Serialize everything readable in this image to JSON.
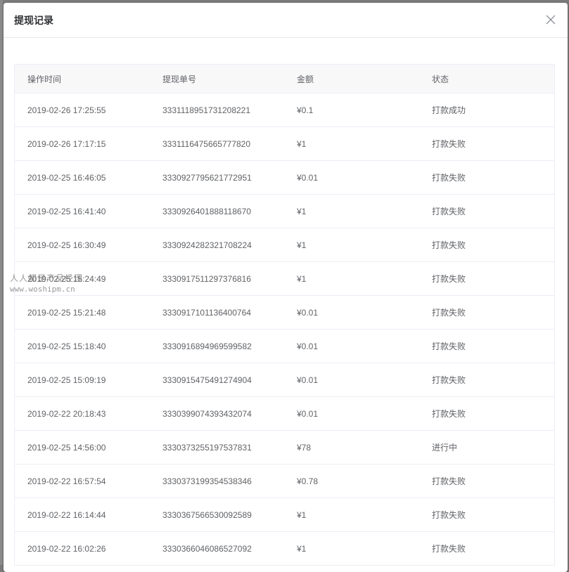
{
  "dialog": {
    "title": "提现记录",
    "close_icon": "close-icon"
  },
  "table": {
    "headers": [
      "操作时间",
      "提现单号",
      "金额",
      "状态"
    ],
    "rows": [
      [
        "2019-02-26 17:25:55",
        "3331118951731208221",
        "¥0.1",
        "打款成功"
      ],
      [
        "2019-02-26 17:17:15",
        "3331116475665777820",
        "¥1",
        "打款失败"
      ],
      [
        "2019-02-25 16:46:05",
        "3330927795621772951",
        "¥0.01",
        "打款失败"
      ],
      [
        "2019-02-25 16:41:40",
        "3330926401888118670",
        "¥1",
        "打款失败"
      ],
      [
        "2019-02-25 16:30:49",
        "3330924282321708224",
        "¥1",
        "打款失败"
      ],
      [
        "2019-02-25 15:24:49",
        "3330917511297376816",
        "¥1",
        "打款失败"
      ],
      [
        "2019-02-25 15:21:48",
        "3330917101136400764",
        "¥0.01",
        "打款失败"
      ],
      [
        "2019-02-25 15:18:40",
        "3330916894969599582",
        "¥0.01",
        "打款失败"
      ],
      [
        "2019-02-25 15:09:19",
        "3330915475491274904",
        "¥0.01",
        "打款失败"
      ],
      [
        "2019-02-22 20:18:43",
        "3330399074393432074",
        "¥0.01",
        "打款失败"
      ],
      [
        "2019-02-25 14:56:00",
        "3330373255197537831",
        "¥78",
        "进行中"
      ],
      [
        "2019-02-22 16:57:54",
        "3330373199354538346",
        "¥0.78",
        "打款失败"
      ],
      [
        "2019-02-22 16:14:44",
        "3330367566530092589",
        "¥1",
        "打款失败"
      ],
      [
        "2019-02-22 16:02:26",
        "3330366046086527092",
        "¥1",
        "打款失败"
      ]
    ]
  },
  "watermark": {
    "line1": "人人都是产品经理",
    "line2": "www.woshipm.cn"
  }
}
